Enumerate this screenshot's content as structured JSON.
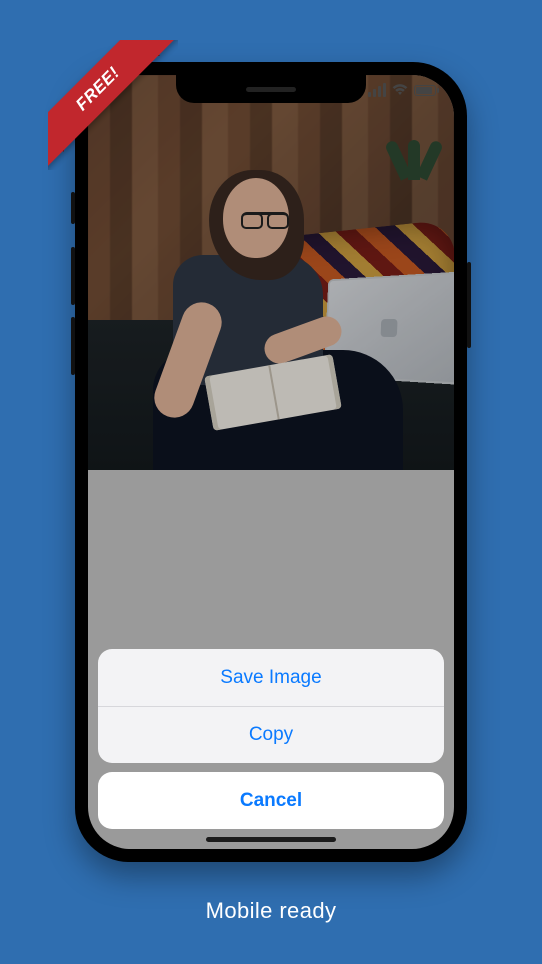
{
  "ribbon": {
    "label": "FREE!"
  },
  "actionSheet": {
    "options": [
      {
        "label": "Save Image"
      },
      {
        "label": "Copy"
      }
    ],
    "cancel": "Cancel"
  },
  "tagline": "Mobile ready"
}
